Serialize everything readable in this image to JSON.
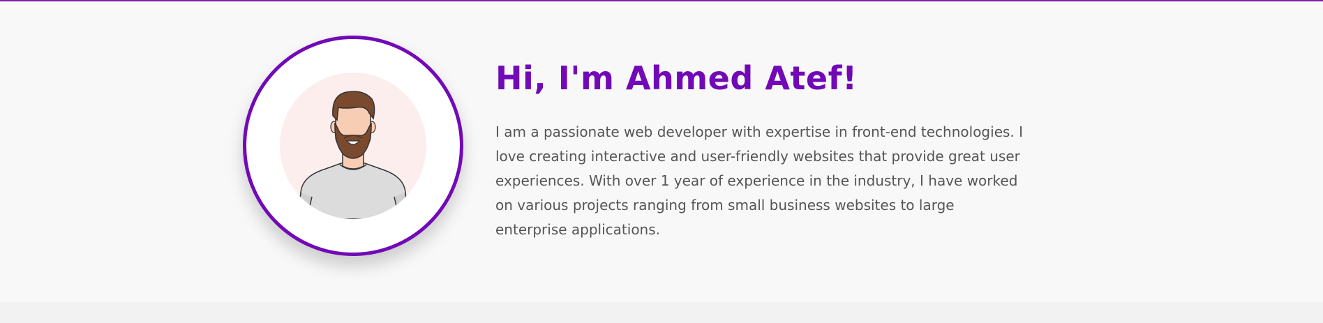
{
  "hero": {
    "greeting": "Hi, I'm Ahmed Atef!",
    "bio": "I am a passionate web developer with expertise in front-end technologies. I love creating interactive and user-friendly websites that provide great user experiences. With over 1 year of experience in the industry, I have worked on various projects ranging from small business websites to large enterprise applications.",
    "avatar_icon": "bearded-man-avatar-icon"
  },
  "colors": {
    "accent": "#7209b7",
    "top_border": "#7b1fa2",
    "text": "#555555",
    "avatar_background": "#fdeeee"
  }
}
